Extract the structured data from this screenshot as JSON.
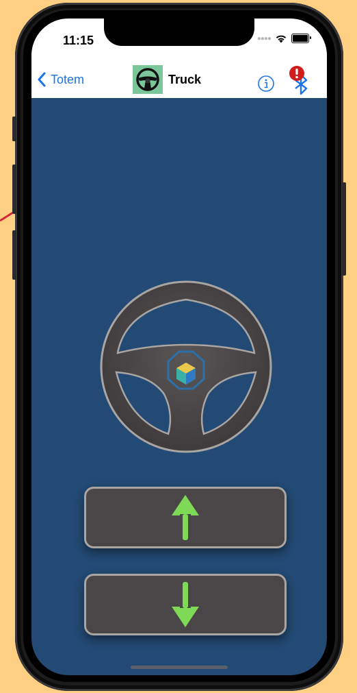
{
  "status_bar": {
    "time": "11:15"
  },
  "nav": {
    "back_label": "Totem",
    "title": "Truck",
    "title_icon": "steering-wheel-icon",
    "info_icon": "info-icon",
    "bluetooth_icon": "bluetooth-icon",
    "alert_icon": "exclamation-badge-icon"
  },
  "controls": {
    "wheel_icon": "steering-wheel-icon",
    "forward_icon": "arrow-up-icon",
    "reverse_icon": "arrow-down-icon"
  },
  "colors": {
    "background": "#ffd084",
    "screen": "#234a74",
    "accent": "#1a73e8",
    "arrow": "#7ed957",
    "alert": "#d01c1c",
    "annotation_line": "#d0253a",
    "button": "#4a4546"
  }
}
